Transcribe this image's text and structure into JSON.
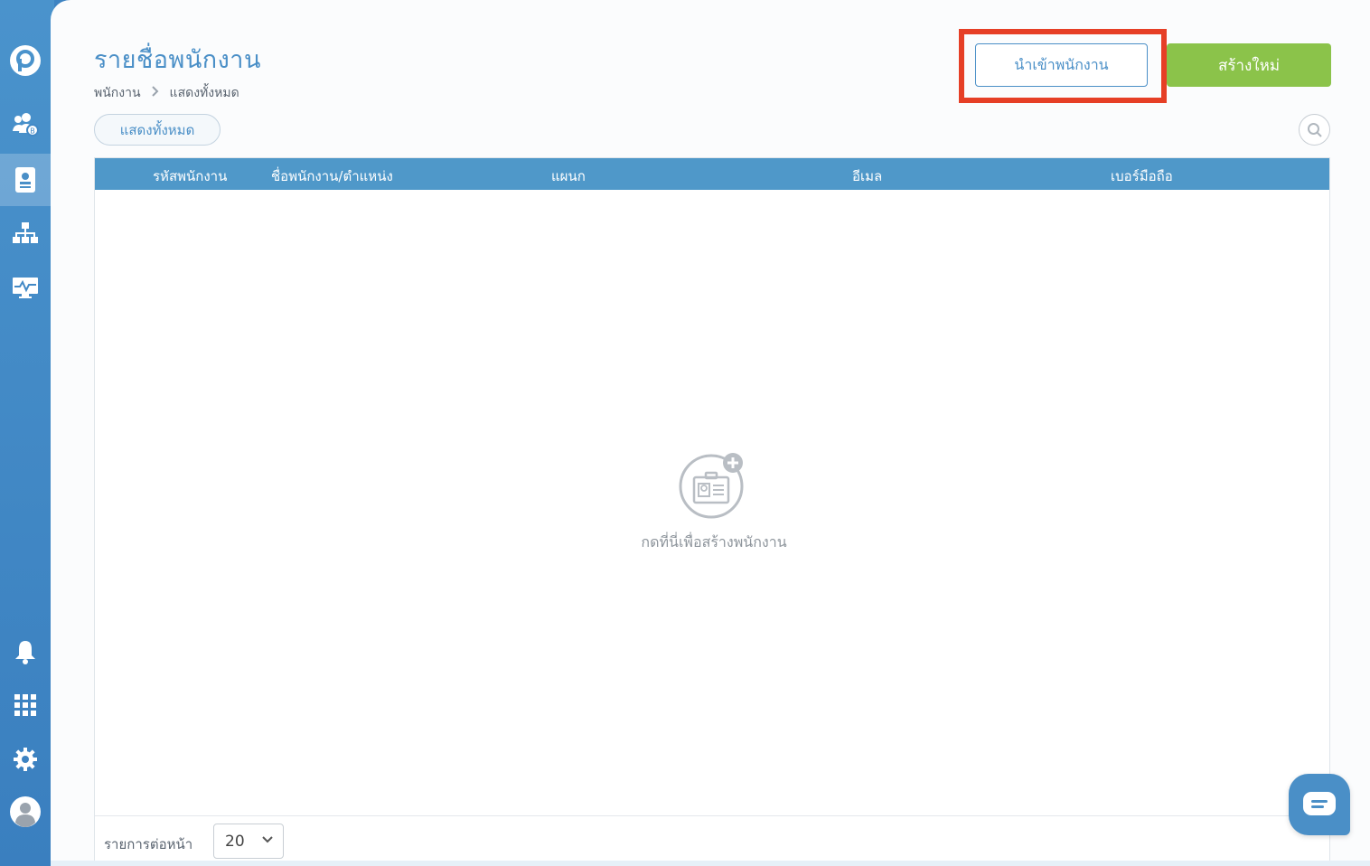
{
  "sidebar": {
    "items": [
      {
        "icon": "logo-icon"
      },
      {
        "icon": "user-group-icon"
      },
      {
        "icon": "employee-card-icon",
        "active": true
      },
      {
        "icon": "org-chart-icon"
      },
      {
        "icon": "monitor-activity-icon"
      },
      {
        "icon": "bell-icon"
      },
      {
        "icon": "apps-grid-icon"
      },
      {
        "icon": "gear-icon"
      },
      {
        "icon": "avatar-icon"
      }
    ]
  },
  "header": {
    "title": "รายชื่อพนักงาน",
    "breadcrumb": [
      "พนักงาน",
      "แสดงทั้งหมด"
    ],
    "import_label": "นำเข้าพนักงาน",
    "create_label": "สร้างใหม่"
  },
  "filter": {
    "label": "แสดงทั้งหมด"
  },
  "table": {
    "columns": [
      "รหัสพนักงาน",
      "ชื่อพนักงาน/ตำแหน่ง",
      "แผนก",
      "อีเมล",
      "เบอร์มือถือ"
    ],
    "rows": [],
    "empty_text": "กดที่นี่เพื่อสร้างพนักงาน"
  },
  "pagination": {
    "per_page_label": "รายการต่อหน้า",
    "per_page_value": "20"
  },
  "colors": {
    "primary": "#4a8fc7",
    "accent_green": "#8bc34a",
    "highlight_red": "#e63f26",
    "table_header": "#4f98c9"
  }
}
